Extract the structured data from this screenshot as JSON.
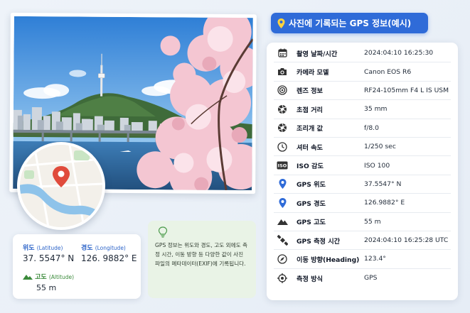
{
  "title": "사진에 기록되는 GPS 정보(예시)",
  "colors": {
    "accent": "#2f6bd8",
    "pin": "#e04b3c",
    "altitude": "#3a8a3a",
    "note_bg": "#e9f3e6"
  },
  "coords": {
    "latitude_label": "위도",
    "latitude_sub": "(Latitude)",
    "latitude_value": "37. 5547° N",
    "longitude_label": "경도",
    "longitude_sub": "(Longitude)",
    "longitude_value": "126. 9882° E",
    "altitude_label": "고도",
    "altitude_sub": "(Altitude)",
    "altitude_value": "55 m"
  },
  "note": "GPS 정보는 위도와 경도, 고도 외에도 측정 시간, 이동 방향 등 다양한 값이 사진 파일의 메타데이터(EXIF)에 기록됩니다.",
  "rows": [
    {
      "icon": "calendar-icon",
      "label": "촬영 날짜/시간",
      "value": "2024:04:10  16:25:30"
    },
    {
      "icon": "camera-icon",
      "label": "카메라 모델",
      "value": "Canon EOS R6"
    },
    {
      "icon": "lens-icon",
      "label": "렌즈 정보",
      "value": "RF24-105mm F4 L IS USM"
    },
    {
      "icon": "aperture-icon",
      "label": "초점 거리",
      "value": "35 mm"
    },
    {
      "icon": "aperture-icon",
      "label": "조리개 값",
      "value": "f/8.0"
    },
    {
      "icon": "clock-icon",
      "label": "셔터 속도",
      "value": "1/250 sec"
    },
    {
      "icon": "iso-icon",
      "label": "ISO 감도",
      "value": "ISO 100"
    },
    {
      "icon": "pin-icon",
      "label": "GPS 위도",
      "value": "37.5547° N"
    },
    {
      "icon": "pin-icon",
      "label": "GPS 경도",
      "value": "126.9882° E"
    },
    {
      "icon": "mountain-icon",
      "label": "GPS 고도",
      "value": "55 m"
    },
    {
      "icon": "satellite-icon",
      "label": "GPS 측정 시간",
      "value": "2024:04:10  16:25:28 UTC"
    },
    {
      "icon": "compass-icon",
      "label": "이동 방향(Heading)",
      "value": "123.4°"
    },
    {
      "icon": "crosshair-icon",
      "label": "측정 방식",
      "value": "GPS"
    }
  ]
}
